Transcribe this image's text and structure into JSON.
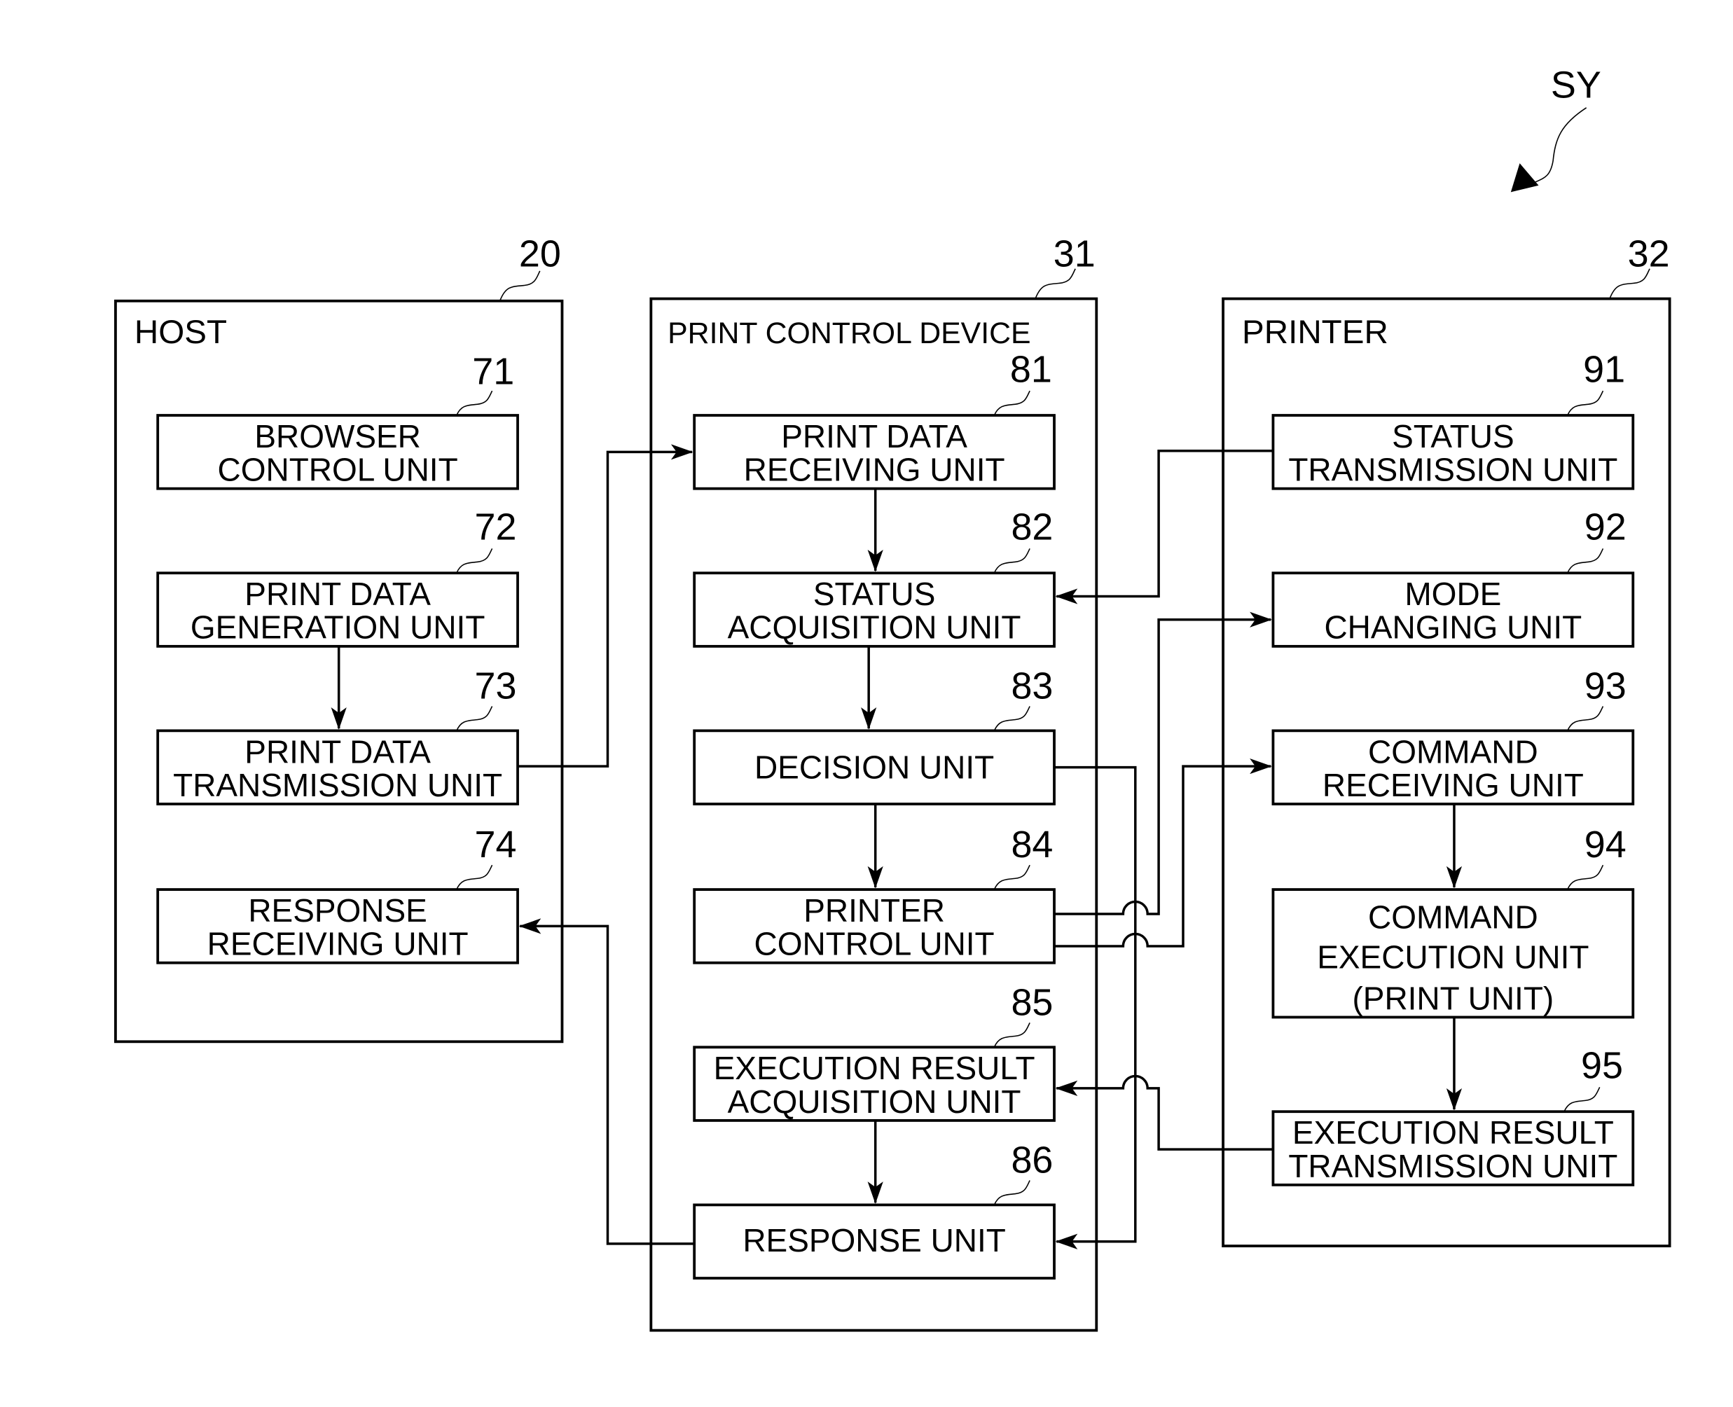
{
  "figure": {
    "system_ref": "SY",
    "colors": {
      "line": "#000000",
      "background": "#ffffff"
    }
  },
  "host": {
    "ref": "20",
    "title": "HOST",
    "units": [
      {
        "ref": "71",
        "lines": [
          "BROWSER",
          "CONTROL UNIT"
        ]
      },
      {
        "ref": "72",
        "lines": [
          "PRINT DATA",
          "GENERATION UNIT"
        ]
      },
      {
        "ref": "73",
        "lines": [
          "PRINT DATA",
          "TRANSMISSION UNIT"
        ]
      },
      {
        "ref": "74",
        "lines": [
          "RESPONSE",
          "RECEIVING UNIT"
        ]
      }
    ]
  },
  "print_control_device": {
    "ref": "31",
    "title": "PRINT CONTROL DEVICE",
    "units": [
      {
        "ref": "81",
        "lines": [
          "PRINT DATA",
          "RECEIVING UNIT"
        ]
      },
      {
        "ref": "82",
        "lines": [
          "STATUS",
          "ACQUISITION UNIT"
        ]
      },
      {
        "ref": "83",
        "lines": [
          "DECISION UNIT"
        ]
      },
      {
        "ref": "84",
        "lines": [
          "PRINTER",
          "CONTROL UNIT"
        ]
      },
      {
        "ref": "85",
        "lines": [
          "EXECUTION RESULT",
          "ACQUISITION UNIT"
        ]
      },
      {
        "ref": "86",
        "lines": [
          "RESPONSE UNIT"
        ]
      }
    ]
  },
  "printer": {
    "ref": "32",
    "title": "PRINTER",
    "units": [
      {
        "ref": "91",
        "lines": [
          "STATUS",
          "TRANSMISSION UNIT"
        ]
      },
      {
        "ref": "92",
        "lines": [
          "MODE",
          "CHANGING UNIT"
        ]
      },
      {
        "ref": "93",
        "lines": [
          "COMMAND",
          "RECEIVING UNIT"
        ]
      },
      {
        "ref": "94",
        "lines": [
          "COMMAND",
          "EXECUTION UNIT",
          "(PRINT UNIT)"
        ]
      },
      {
        "ref": "95",
        "lines": [
          "EXECUTION RESULT",
          "TRANSMISSION UNIT"
        ]
      }
    ]
  },
  "connections": [
    {
      "from": "72",
      "to": "73"
    },
    {
      "from": "73",
      "to": "81"
    },
    {
      "from": "81",
      "to": "82"
    },
    {
      "from": "82",
      "to": "83"
    },
    {
      "from": "83",
      "to": "84"
    },
    {
      "from": "83",
      "to": "86"
    },
    {
      "from": "91",
      "to": "82"
    },
    {
      "from": "84",
      "to": "92"
    },
    {
      "from": "84",
      "to": "93"
    },
    {
      "from": "93",
      "to": "94"
    },
    {
      "from": "94",
      "to": "95"
    },
    {
      "from": "95",
      "to": "85"
    },
    {
      "from": "85",
      "to": "86"
    },
    {
      "from": "86",
      "to": "74"
    }
  ]
}
